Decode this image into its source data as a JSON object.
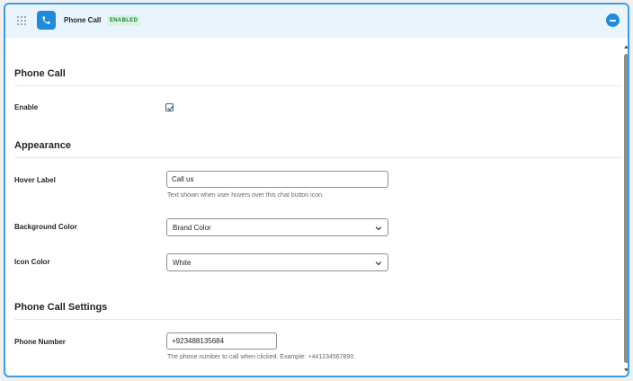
{
  "header": {
    "title": "Phone Call",
    "status_badge": "ENABLED"
  },
  "sections": {
    "phone_call": {
      "title": "Phone Call",
      "enable_label": "Enable",
      "enable_checked": true
    },
    "appearance": {
      "title": "Appearance",
      "hover_label": {
        "label": "Hover Label",
        "value": "Call us",
        "help": "Text shown when user hovers over this chat button icon."
      },
      "background_color": {
        "label": "Background Color",
        "selected": "Brand Color"
      },
      "icon_color": {
        "label": "Icon Color",
        "selected": "White"
      }
    },
    "phone_call_settings": {
      "title": "Phone Call Settings",
      "phone_number": {
        "label": "Phone Number",
        "value": "+923488135684",
        "help": "The phone number to call when clicked. Example: +441234567890."
      }
    }
  },
  "icons": {
    "drag": "drag-handle-icon",
    "app": "phone-icon",
    "collapse": "minus-circle-icon",
    "checkbox": "checkmark-icon",
    "select": "chevron-down-icon"
  },
  "colors": {
    "accent": "#1e8cdb",
    "header_bg": "#eaf4fc",
    "badge_bg": "#d9f5e2",
    "badge_text": "#1a7f37",
    "border": "#3a9de6"
  }
}
